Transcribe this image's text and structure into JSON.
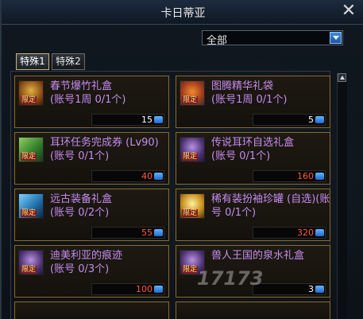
{
  "window": {
    "title": "卡日蒂亚"
  },
  "filter": {
    "selected": "全部"
  },
  "tabs": [
    {
      "label": "特殊1",
      "active": true
    },
    {
      "label": "特殊2",
      "active": false
    }
  ],
  "items": [
    {
      "name": "春节爆竹礼盒\n(账号1周 0/1个)",
      "badge": "限定",
      "count": "15",
      "count_color": "white"
    },
    {
      "name": "图腾精华礼袋\n(账号1周 0/1个)",
      "badge": "限定",
      "count": "5",
      "count_color": "white"
    },
    {
      "name": "耳环任务完成券 (Lv90)(账号 0/1个)",
      "badge": "限定",
      "count": "40",
      "count_color": "red"
    },
    {
      "name": "传说耳环自选礼盒\n(账号 0/1个)",
      "badge": "限定",
      "count": "160",
      "count_color": "red"
    },
    {
      "name": "远古装备礼盒\n(账号 0/2个)",
      "badge": "限定",
      "count": "55",
      "count_color": "red"
    },
    {
      "name": "稀有装扮袖珍罐 (自选)(账号 0/1个)",
      "badge": "限定",
      "count": "320",
      "count_color": "red"
    },
    {
      "name": "迪美利亚的痕迹\n(账号 0/3个)",
      "badge": "限定",
      "count": "100",
      "count_color": "red"
    },
    {
      "name": "兽人王国的泉水礼盒",
      "badge": "限定",
      "count": "3",
      "count_color": "white"
    }
  ],
  "watermark": "17173",
  "colors": {
    "item_name": "#c58cf0",
    "item_border": "#8a6a28",
    "count_red": "#ff5a3a"
  }
}
